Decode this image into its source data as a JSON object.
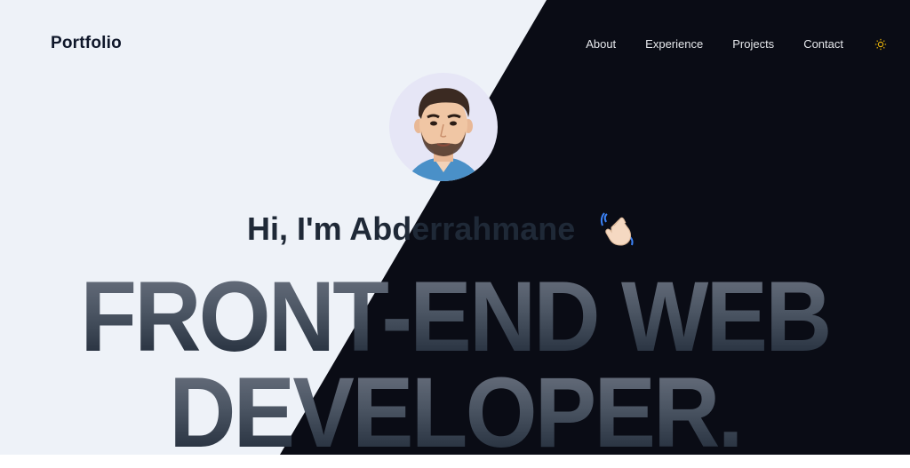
{
  "header": {
    "brand": "Portfolio",
    "nav": [
      {
        "label": "About"
      },
      {
        "label": "Experience"
      },
      {
        "label": "Projects"
      },
      {
        "label": "Contact"
      }
    ],
    "theme_icon": "sun-icon",
    "theme_icon_color": "#eab308"
  },
  "hero": {
    "avatar_icon": "cartoon-man-avatar",
    "greeting": "Hi, I'm Abderrahmane",
    "wave_icon": "waving-hand-icon",
    "headline_line1": "FRONT-END WEB",
    "headline_line2": "DEVELOPER."
  },
  "colors": {
    "light_bg": "#eef2f8",
    "dark_bg": "#0a0c15"
  }
}
